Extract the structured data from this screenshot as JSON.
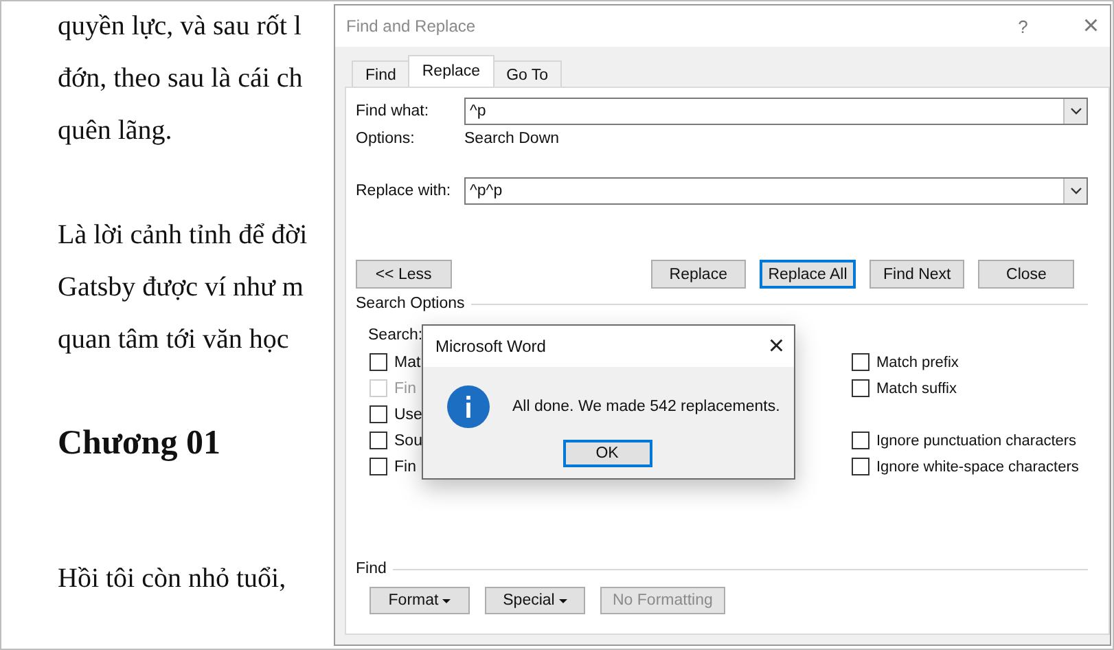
{
  "document": {
    "blocks": [
      {
        "kind": "text",
        "lines": [
          "quyền lực, và sau rốt l",
          "đớn, theo sau là cái ch",
          "quên lãng."
        ]
      },
      {
        "kind": "text",
        "lines": [
          "Là lời cảnh tỉnh để đời",
          "Gatsby được ví như m",
          "quan tâm tới văn học"
        ]
      },
      {
        "kind": "heading",
        "lines": [
          "Chương 01"
        ]
      },
      {
        "kind": "text",
        "lines": [
          "Hồi tôi còn nhỏ tuổi,"
        ]
      }
    ]
  },
  "dialog": {
    "title": "Find and Replace",
    "help": "?",
    "close": "×",
    "tabs": [
      {
        "label": "Find",
        "selected": false
      },
      {
        "label": "Replace",
        "selected": true
      },
      {
        "label": "Go To",
        "selected": false
      }
    ],
    "find_what": {
      "label": "Find what:",
      "value": "^p"
    },
    "options": {
      "label": "Options:",
      "value": "Search Down"
    },
    "replace_with": {
      "label": "Replace with:",
      "value": "^p^p"
    },
    "buttons": [
      {
        "label": "<< Less",
        "default": false
      },
      {
        "label": "Replace",
        "default": false
      },
      {
        "label": "Replace All",
        "default": true
      },
      {
        "label": "Find Next",
        "default": false
      },
      {
        "label": "Close",
        "default": false
      }
    ],
    "search_options": {
      "heading": "Search Options",
      "search_label": "Search:",
      "left": [
        {
          "label": "Mat",
          "checked": false,
          "disabled": false
        },
        {
          "label": "Fin",
          "checked": false,
          "disabled": true
        },
        {
          "label": "Use",
          "checked": false,
          "disabled": false
        },
        {
          "label": "Sou",
          "checked": false,
          "disabled": false
        },
        {
          "label": "Fin",
          "checked": false,
          "disabled": false
        }
      ],
      "right": [
        {
          "label": "Match prefix",
          "checked": false
        },
        {
          "label": "Match suffix",
          "checked": false
        },
        {
          "label": "Ignore punctuation characters",
          "checked": false
        },
        {
          "label": "Ignore white-space characters",
          "checked": false
        }
      ]
    },
    "find_section": {
      "heading": "Find",
      "buttons": [
        {
          "label": "Format",
          "dropdown": true,
          "disabled": false
        },
        {
          "label": "Special",
          "dropdown": true,
          "disabled": false
        },
        {
          "label": "No Formatting",
          "dropdown": false,
          "disabled": true
        }
      ]
    }
  },
  "message_box": {
    "title": "Microsoft Word",
    "close": "×",
    "message": "All done. We made 542 replacements.",
    "button": "OK"
  }
}
